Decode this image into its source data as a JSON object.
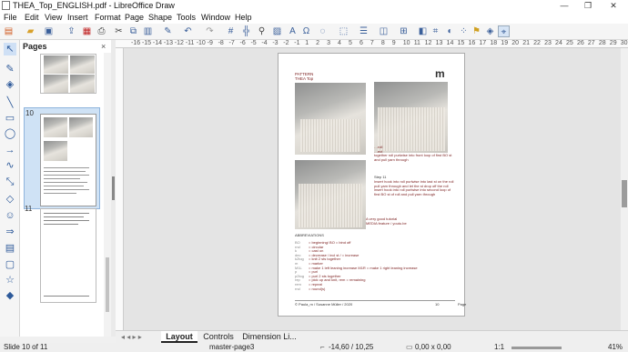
{
  "window": {
    "title": "THEA_Top_ENGLISH.pdf - LibreOffice Draw",
    "minimize": "—",
    "maximize": "❐",
    "close": "✕"
  },
  "menu": [
    "File",
    "Edit",
    "View",
    "Insert",
    "Format",
    "Page",
    "Shape",
    "Tools",
    "Window",
    "Help"
  ],
  "ruler": [
    "-16",
    "-15",
    "-14",
    "-13",
    "-12",
    "-11",
    "-10",
    "-9",
    "-8",
    "-7",
    "-6",
    "-5",
    "-4",
    "-3",
    "-2",
    "-1",
    "1",
    "2",
    "3",
    "4",
    "5",
    "6",
    "7",
    "8",
    "9",
    "10",
    "11",
    "12",
    "13",
    "14",
    "15",
    "16",
    "17",
    "18",
    "19",
    "20",
    "21",
    "22",
    "23",
    "24",
    "25",
    "26",
    "27",
    "28",
    "29",
    "30",
    "31"
  ],
  "pages_panel": {
    "title": "Pages",
    "close": "×",
    "page10": "10",
    "page11": "11"
  },
  "document": {
    "heading1": "PATTERN",
    "heading2": "THEA Top",
    "page_mark": "m",
    "step_text_a": "…roll\n…ect\ntogether roll purlwise into front loop of first BO st\nand pull yarn through",
    "step_label": "Step 11",
    "step_text_b": "Insert hook into roll purlwise into last st on the roll\npull yarn through and let the st drop off the roll\ninsert hook into roll purlwise into second loop of\nfirst BO st of roll and pull yarn through",
    "tutorial": "A very good tutorial\nMEDIA feature / youtu.be",
    "abbrev_title": "ABBREVIATIONS",
    "abbrev_keys": "BO\nrnd\nk\ndec\nk2tog\nm\nM1L\np\np2tog\nrep\nrem\nrnd",
    "abbrev_vals": "= beginning/ BO = bind off\n= circular\n= cast on\n= decrease / incl st / = increase\n= knit 2 sts together\n= marker\n= make 1 left leaning increase M1R = make 1 right leaning increase\n= purl\n= purl 2 sts together\n= pick up and knit, rem = remaining\n= repeat\n= round(s)",
    "footer_left": "© Paula_m / Susanne Müller / 2020",
    "footer_page": "10",
    "footer_right": "Page"
  },
  "tabs": {
    "nav": "◂ ◂ ▸ ▸",
    "layout": "Layout",
    "controls": "Controls",
    "dimension": "Dimension Li..."
  },
  "status": {
    "slide": "Slide 10 of 11",
    "master": "master-page3",
    "position": "-14,60 / 10,25",
    "size": "0,00 x 0,00",
    "scale": "1:1",
    "zoom": "41%"
  },
  "colors": {
    "accent": "#2e5a9a",
    "text_red": "#7a1d1d",
    "canvas": "#e4e4e4"
  }
}
